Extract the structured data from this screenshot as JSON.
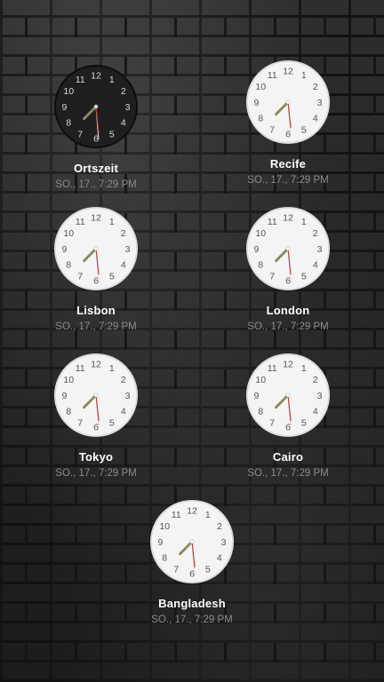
{
  "colors": {
    "face_light": "#f4f4f4",
    "face_dark": "#1f1f1f",
    "hour_hand": "#8b8a5c",
    "minute_hand": "#dcdcdc",
    "second_hand": "#c0392b",
    "label_text": "#ffffff",
    "time_text": "#8a8a8a"
  },
  "clock": {
    "hour": 7,
    "minute": 29,
    "second": 15,
    "dial_numbers": [
      "12",
      "1",
      "2",
      "3",
      "4",
      "5",
      "6",
      "7",
      "8",
      "9",
      "10",
      "11"
    ]
  },
  "clocks": [
    {
      "id": "ortszeit",
      "city": "Ortszeit",
      "time_text": "SO., 17., 7:29 PM",
      "theme": "dark"
    },
    {
      "id": "recife",
      "city": "Recife",
      "time_text": "SO., 17., 7:29 PM",
      "theme": "light"
    },
    {
      "id": "lisbon",
      "city": "Lisbon",
      "time_text": "SO., 17., 7:29 PM",
      "theme": "light"
    },
    {
      "id": "london",
      "city": "London",
      "time_text": "SO., 17., 7:29 PM",
      "theme": "light"
    },
    {
      "id": "tokyo",
      "city": "Tokyo",
      "time_text": "SO., 17., 7:29 PM",
      "theme": "light"
    },
    {
      "id": "cairo",
      "city": "Cairo",
      "time_text": "SO., 17., 7:29 PM",
      "theme": "light"
    },
    {
      "id": "bangladesh",
      "city": "Bangladesh",
      "time_text": "SO., 17., 7:29 PM",
      "theme": "light"
    }
  ]
}
